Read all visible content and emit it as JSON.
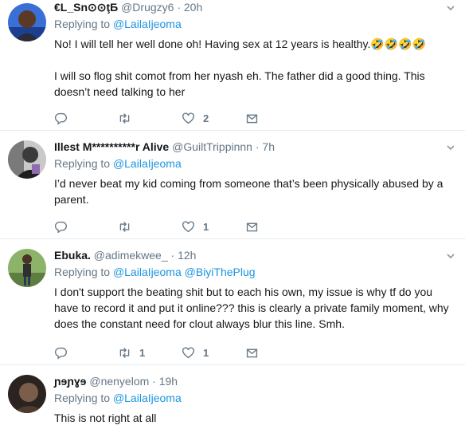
{
  "tweets": [
    {
      "name": "€L_Sn⊙⊙ţБ",
      "handle": "@Drugzy6",
      "time": "20h",
      "replying_label": "Replying to",
      "mentions": [
        "@LailaIjeoma"
      ],
      "text_lines": [
        "No! I will tell her well done oh! Having sex at 12 years is healthy.🤣🤣🤣🤣",
        "",
        "I will so flog shit comot from her nyash eh. The father did a good thing. This doesn’t need talking to her"
      ],
      "replies": "",
      "retweets": "",
      "likes": "2"
    },
    {
      "name": "Illest M**********r Alive",
      "handle": "@GuiltTrippinnn",
      "time": "7h",
      "replying_label": "Replying to",
      "mentions": [
        "@LailaIjeoma"
      ],
      "text_lines": [
        "I’d never beat my kid coming from someone that’s been physically abused by a parent."
      ],
      "replies": "",
      "retweets": "",
      "likes": "1"
    },
    {
      "name": "Ebuka.",
      "handle": "@adimekwee_",
      "time": "12h",
      "replying_label": "Replying to",
      "mentions": [
        "@LailaIjeoma",
        "@BiyiThePlug"
      ],
      "text_lines": [
        "I don't support the beating shit but to each his own, my issue is why tf do you have to record it and put it online??? this is clearly a private family moment, why does the constant need for clout always blur this line. Smh."
      ],
      "replies": "",
      "retweets": "1",
      "likes": "1"
    },
    {
      "name": "ɲɘɲɣɘ",
      "handle": "@nenyelom",
      "time": "19h",
      "replying_label": "Replying to",
      "mentions": [
        "@LailaIjeoma"
      ],
      "text_lines": [
        "This is not right at all"
      ],
      "replies": "",
      "retweets": "",
      "likes": ""
    }
  ],
  "separator": "·",
  "icons": {
    "reply": "reply-icon",
    "retweet": "retweet-icon",
    "like": "heart-icon",
    "dm": "envelope-icon",
    "more": "chevron-down-icon"
  },
  "colors": {
    "link": "#1b95e0",
    "muted": "#657786",
    "text": "#14171a",
    "divider": "#e6ecf0"
  }
}
